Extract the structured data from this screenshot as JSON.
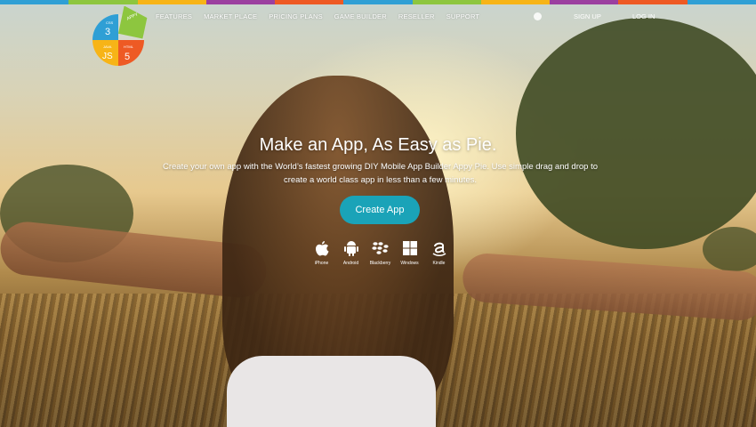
{
  "topbar": {
    "colors": [
      "#2f9fd5",
      "#8dc63f",
      "#f7b417",
      "#9b3fa0",
      "#ee5a24",
      "#2f9fd5",
      "#8dc63f",
      "#f7b417",
      "#9b3fa0",
      "#ee5a24",
      "#2f9fd5"
    ]
  },
  "logo": {
    "icon": "appy-pie-logo",
    "lines": [
      "CSS",
      "3",
      "APPY",
      "JAVA",
      "JS",
      "HTML",
      "5"
    ]
  },
  "nav": {
    "items": [
      {
        "label": "FEATURES"
      },
      {
        "label": "MARKET PLACE"
      },
      {
        "label": "PRICING PLANS"
      },
      {
        "label": "GAME BUILDER"
      },
      {
        "label": "RESELLER"
      },
      {
        "label": "SUPPORT"
      }
    ],
    "globe_icon": "globe-icon",
    "signup": "SIGN UP",
    "login": "LOG IN"
  },
  "hero": {
    "title": "Make an App, As Easy as Pie.",
    "subtitle": "Create your own app with the World’s fastest growing DIY Mobile App Builder Appy Pie. Use simple drag and drop to create a world class app in less than a few minutes.",
    "cta": "Create App"
  },
  "platforms": [
    {
      "icon": "apple-icon",
      "label": "iPhone"
    },
    {
      "icon": "android-icon",
      "label": "Android"
    },
    {
      "icon": "blackberry-icon",
      "label": "Blackberry"
    },
    {
      "icon": "windows-icon",
      "label": "Windows"
    },
    {
      "icon": "amazon-icon",
      "label": "Kindle"
    }
  ]
}
